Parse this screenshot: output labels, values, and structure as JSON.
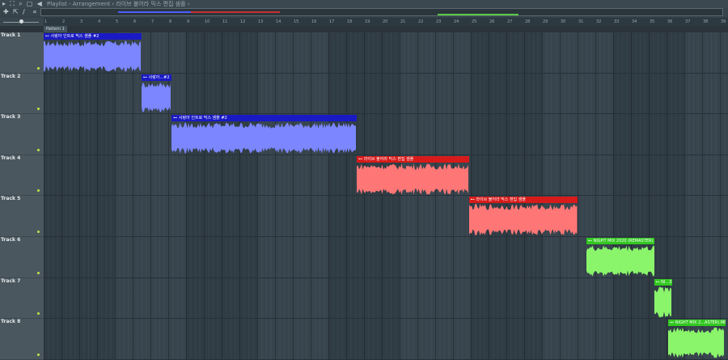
{
  "titlebar": {
    "title": "Playlist - Arrangement › 라이브 불어라 믹스 편집 샘플 ›"
  },
  "toolbar": {
    "snap_label": "∝"
  },
  "pattern": {
    "label": "Pattern 1"
  },
  "ruler": {
    "bars": [
      "1",
      "2",
      "3",
      "4",
      "5",
      "6",
      "7",
      "8",
      "9",
      "10",
      "11",
      "12",
      "13",
      "14",
      "15",
      "16",
      "17",
      "18",
      "19",
      "20",
      "21",
      "22",
      "23",
      "24",
      "25",
      "26",
      "27",
      "28",
      "29",
      "30",
      "31",
      "32",
      "33",
      "34",
      "35",
      "36",
      "37",
      "38",
      "39"
    ]
  },
  "tracks": [
    {
      "label": "Track 1"
    },
    {
      "label": "Track 2"
    },
    {
      "label": "Track 3"
    },
    {
      "label": "Track 4"
    },
    {
      "label": "Track 5"
    },
    {
      "label": "Track 6"
    },
    {
      "label": "Track 7"
    },
    {
      "label": "Track 8"
    }
  ],
  "clips": [
    {
      "name": "사랑아 인트로 믹스 샘플 #2",
      "track": 1,
      "start": 1,
      "end": 6.5,
      "color": "#7b86ff",
      "hdr": "#1a1ac4"
    },
    {
      "name": "사랑아...#2",
      "track": 2,
      "start": 6.5,
      "end": 8.2,
      "color": "#7b86ff",
      "hdr": "#1a1ac4"
    },
    {
      "name": "사랑아 인트로 믹스 샘플 #2",
      "track": 3,
      "start": 8.2,
      "end": 18.6,
      "color": "#7b86ff",
      "hdr": "#1a1ac4"
    },
    {
      "name": "라이브 불어라 믹스 편집 샘플",
      "track": 4,
      "start": 18.6,
      "end": 24.9,
      "color": "#ff7676",
      "hdr": "#d71a1a"
    },
    {
      "name": "라이브 불어라 믹스 편집 샘플",
      "track": 5,
      "start": 24.9,
      "end": 31,
      "color": "#ff7676",
      "hdr": "#d71a1a"
    },
    {
      "name": "NIGHT MIX 2020 (REMASTER).MP3",
      "track": 6,
      "start": 31.5,
      "end": 35.3,
      "color": "#8af56a",
      "hdr": "#32c820"
    },
    {
      "name": "NI...3",
      "track": 7,
      "start": 35.3,
      "end": 36.3,
      "color": "#8af56a",
      "hdr": "#32c820"
    },
    {
      "name": "NIGHT MIX 2...ASTER).MP3",
      "track": 8,
      "start": 36.1,
      "end": 39.3,
      "color": "#8af56a",
      "hdr": "#32c820"
    }
  ]
}
